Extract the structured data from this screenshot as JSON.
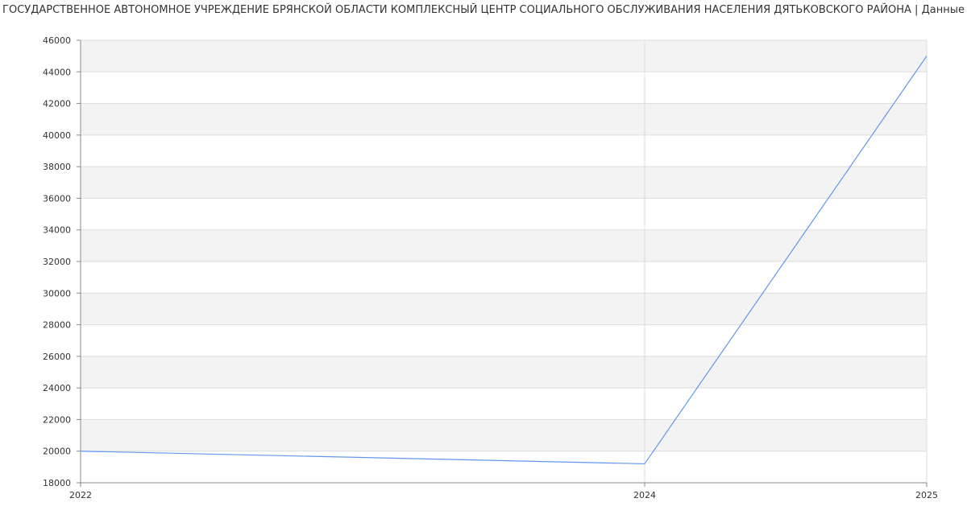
{
  "chart_data": {
    "type": "line",
    "title": "ГОСУДАРСТВЕННОЕ АВТОНОМНОЕ УЧРЕЖДЕНИЕ БРЯНСКОЙ ОБЛАСТИ КОМПЛЕКСНЫЙ ЦЕНТР СОЦИАЛЬНОГО ОБСЛУЖИВАНИЯ НАСЕЛЕНИЯ ДЯТЬКОВСКОГО РАЙОНА | Данные",
    "xlabel": "",
    "ylabel": "",
    "x": [
      2022,
      2024,
      2025
    ],
    "x_ticks": [
      "2022",
      "2024",
      "2025"
    ],
    "series": [
      {
        "values": [
          20000,
          19200,
          45000
        ]
      }
    ],
    "ylim": [
      18000,
      46000
    ],
    "y_ticks": [
      18000,
      20000,
      22000,
      24000,
      26000,
      28000,
      30000,
      32000,
      34000,
      36000,
      38000,
      40000,
      42000,
      44000,
      46000
    ],
    "grid": true,
    "alternating_bands": true,
    "line_color": "#6495ed",
    "band_color": "#f3f3f3",
    "grid_color": "#dddddd",
    "axis_color": "#888888"
  }
}
